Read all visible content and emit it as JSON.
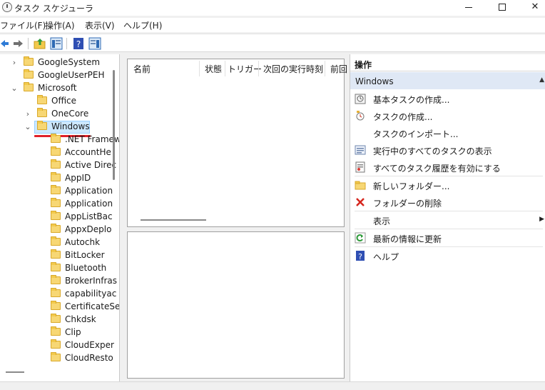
{
  "window": {
    "title": "タスク スケジューラ"
  },
  "menu": [
    "ファイル(F)",
    "操作(A)",
    "表示(V)",
    "ヘルプ(H)"
  ],
  "toolbar": {
    "icons": [
      "back-arrow-icon",
      "forward-arrow-icon",
      "up-folder-icon",
      "show-hide-console-tree-icon",
      "help-icon",
      "show-hide-action-pane-icon"
    ]
  },
  "tree": {
    "items": [
      {
        "label": "GoogleSystem",
        "expander": "›"
      },
      {
        "label": "GoogleUserPEH",
        "expander": ""
      },
      {
        "label": "Microsoft",
        "expander": "⌄"
      },
      {
        "label": "Office",
        "expander": ""
      },
      {
        "label": "OneCore",
        "expander": "›"
      },
      {
        "label": "Windows",
        "expander": "⌄"
      },
      {
        "label": ".NET Framew",
        "expander": ""
      },
      {
        "label": "AccountHe",
        "expander": ""
      },
      {
        "label": "Active Direc",
        "expander": ""
      },
      {
        "label": "AppID",
        "expander": ""
      },
      {
        "label": "Application",
        "expander": ""
      },
      {
        "label": "Application",
        "expander": ""
      },
      {
        "label": "AppListBac",
        "expander": ""
      },
      {
        "label": "AppxDeplo",
        "expander": ""
      },
      {
        "label": "Autochk",
        "expander": ""
      },
      {
        "label": "BitLocker",
        "expander": ""
      },
      {
        "label": "Bluetooth",
        "expander": ""
      },
      {
        "label": "BrokerInfras",
        "expander": ""
      },
      {
        "label": "capabilityac",
        "expander": ""
      },
      {
        "label": "CertificateSe",
        "expander": ""
      },
      {
        "label": "Chkdsk",
        "expander": ""
      },
      {
        "label": "Clip",
        "expander": ""
      },
      {
        "label": "CloudExper",
        "expander": ""
      },
      {
        "label": "CloudResto",
        "expander": ""
      }
    ]
  },
  "task_list": {
    "columns": [
      "名前",
      "状態",
      "トリガー",
      "次回の実行時刻",
      "前回"
    ]
  },
  "actions": {
    "title": "操作",
    "section": "Windows",
    "items": [
      {
        "label": "基本タスクの作成...",
        "icon": "basic-task-icon"
      },
      {
        "label": "タスクの作成...",
        "icon": "create-task-icon"
      },
      {
        "label": "タスクのインポート...",
        "icon": ""
      },
      {
        "label": "実行中のすべてのタスクの表示",
        "icon": "running-tasks-icon"
      },
      {
        "label": "すべてのタスク履歴を有効にする",
        "icon": "task-history-icon"
      },
      {
        "label": "新しいフォルダー...",
        "icon": "new-folder-icon"
      },
      {
        "label": "フォルダーの削除",
        "icon": "delete-icon"
      },
      {
        "label": "表示",
        "icon": ""
      },
      {
        "label": "最新の情報に更新",
        "icon": "refresh-icon"
      },
      {
        "label": "ヘルプ",
        "icon": "help-icon"
      }
    ]
  },
  "colors": {
    "selection_bg": "#cce8ff",
    "section_bg": "#dfe8f5",
    "underline": "#e0202a",
    "folder": "#f7d774"
  }
}
